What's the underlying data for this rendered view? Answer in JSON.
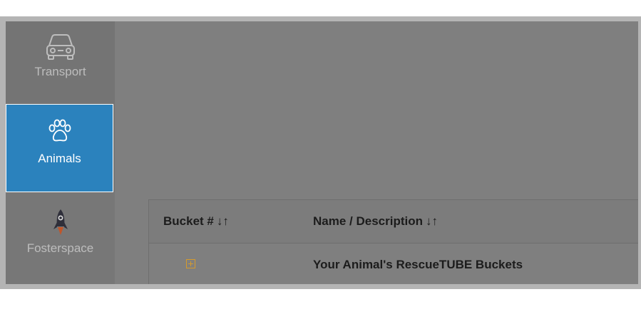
{
  "sidebar": {
    "items": [
      {
        "label": "Transport",
        "icon": "car-icon",
        "selected": false
      },
      {
        "label": "Animals",
        "icon": "paw-icon",
        "selected": true
      },
      {
        "label": "Fosterspace",
        "icon": "rocket-icon",
        "selected": false
      }
    ]
  },
  "table": {
    "columns": [
      {
        "label": "Bucket #",
        "sort": "↓↑"
      },
      {
        "label": "Name / Description",
        "sort": "↓↑"
      }
    ],
    "rows": [
      {
        "bucket_icon": "expand-icon",
        "name": "Your Animal's RescueTUBE Buckets"
      }
    ]
  },
  "colors": {
    "selected_bg": "#2b82bd",
    "overlay": "#7f7f7f",
    "expand_accent": "#d69b2c"
  }
}
